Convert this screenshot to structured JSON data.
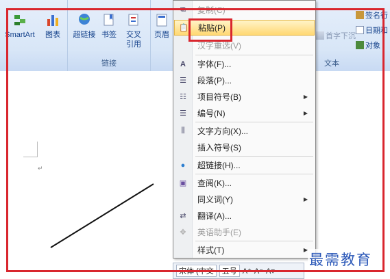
{
  "ribbon": {
    "smartart_label": "SmartArt",
    "chart_label": "图表",
    "hyperlink_label": "超链接",
    "bookmark_label": "书签",
    "crossref_label_1": "交叉",
    "crossref_label_2": "引用",
    "links_group_label": "链接",
    "header_label": "页眉",
    "dropcap_label": "首字下沉",
    "signature_label": "签名行",
    "datetime_label": "日期和",
    "object_label": "对象",
    "text_group_label": "文本"
  },
  "context_menu": {
    "items": [
      {
        "label": "复制(C)",
        "disabled": true
      },
      {
        "label": "粘贴(P)",
        "highlighted": true
      },
      {
        "label": "汉字重选(V)",
        "disabled": true
      },
      {
        "label": "字体(F)..."
      },
      {
        "label": "段落(P)..."
      },
      {
        "label": "项目符号(B)",
        "submenu": true
      },
      {
        "label": "编号(N)",
        "submenu": true
      },
      {
        "label": "文字方向(X)..."
      },
      {
        "label": "插入符号(S)"
      },
      {
        "label": "超链接(H)..."
      },
      {
        "label": "查阅(K)..."
      },
      {
        "label": "同义词(Y)",
        "submenu": true
      },
      {
        "label": "翻译(A)..."
      },
      {
        "label": "英语助手(E)",
        "disabled": true
      },
      {
        "label": "样式(T)",
        "submenu": true
      }
    ]
  },
  "mini_toolbar": {
    "font": "宋体 (中文",
    "size": "五号"
  },
  "watermark": "最需教育",
  "colors": {
    "highlight_frame": "#d9262e",
    "ribbon_bg": "#dbe7f7"
  }
}
